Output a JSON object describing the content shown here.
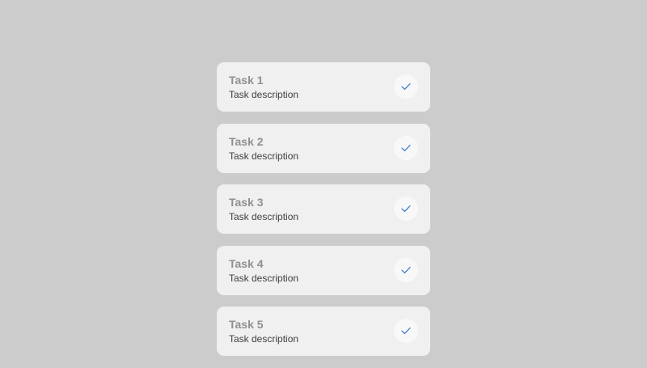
{
  "tasks": [
    {
      "title": "Task 1",
      "description": "Task description",
      "completed": true
    },
    {
      "title": "Task 2",
      "description": "Task description",
      "completed": true
    },
    {
      "title": "Task 3",
      "description": "Task description",
      "completed": true
    },
    {
      "title": "Task 4",
      "description": "Task description",
      "completed": true
    },
    {
      "title": "Task 5",
      "description": "Task description",
      "completed": true
    }
  ],
  "icons": {
    "complete": "check-icon"
  },
  "colors": {
    "background": "#cccccc",
    "card": "#f0f0f0",
    "title": "#909090",
    "description": "#404040",
    "check": "#3d7fd0"
  }
}
